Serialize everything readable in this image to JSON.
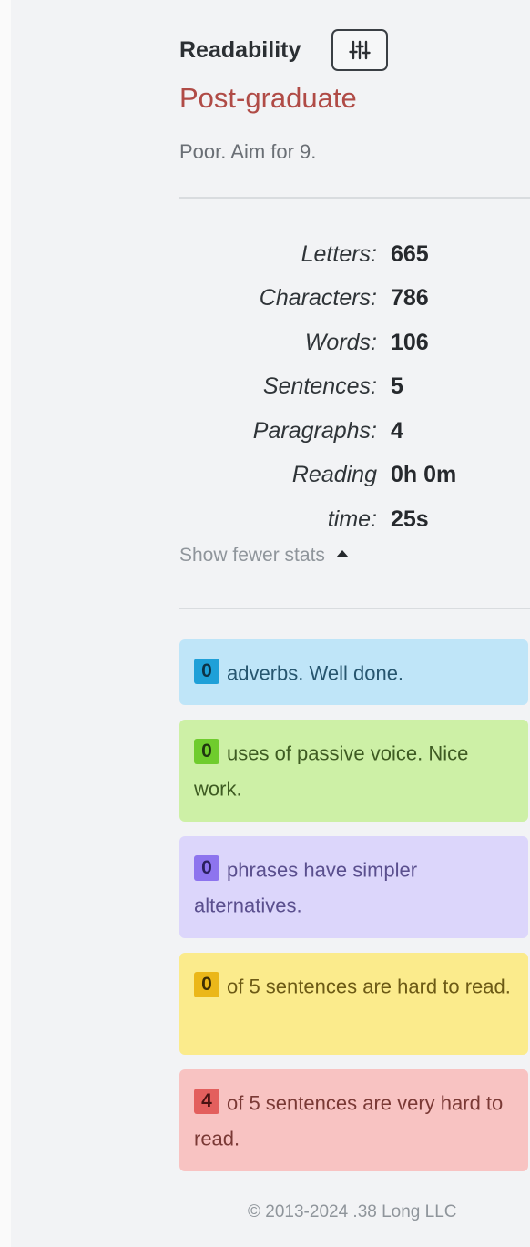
{
  "readability": {
    "title": "Readability",
    "settings_icon": "sliders-icon",
    "grade": "Post-graduate",
    "note": "Poor. Aim for 9."
  },
  "stats": [
    {
      "label": "Letters:",
      "value": "665"
    },
    {
      "label": "Characters:",
      "value": "786"
    },
    {
      "label": "Words:",
      "value": "106"
    },
    {
      "label": "Sentences:",
      "value": "5"
    },
    {
      "label": "Paragraphs:",
      "value": "4"
    },
    {
      "label": "Reading",
      "value": "0h 0m"
    },
    {
      "label": "time:",
      "value": "25s"
    }
  ],
  "show_fewer": {
    "label": "Show fewer stats",
    "icon": "caret-up-icon"
  },
  "cards": {
    "adverbs": {
      "count": "0",
      "text": "adverbs. Well done."
    },
    "passive": {
      "count": "0",
      "text": "uses of passive voice. Nice work."
    },
    "phrases": {
      "count": "0",
      "text": "phrases have simpler alternatives."
    },
    "hard": {
      "count": "0",
      "text": "of 5 sentences are hard to read."
    },
    "very_hard": {
      "count": "4",
      "text": "of 5 sentences are very hard to read."
    }
  },
  "footer": {
    "text": "© 2013-2024 .38 Long LLC"
  },
  "colors": {
    "grade": "#b04b46",
    "adverbs_bg": "#bfe5f8",
    "passive_bg": "#cdf0a6",
    "phrases_bg": "#dcd6fb",
    "hard_bg": "#fbeb8c",
    "very_hard_bg": "#f8c3c2"
  }
}
